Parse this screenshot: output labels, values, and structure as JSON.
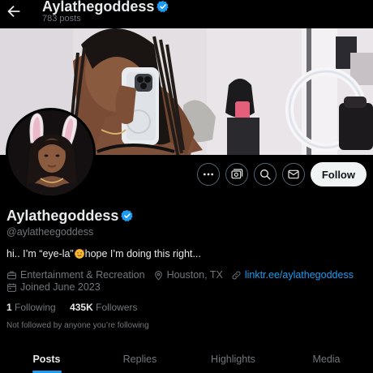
{
  "header": {
    "title": "Aylathegoddess",
    "post_count": "783 posts",
    "back_icon": "arrow-left-icon",
    "verified_icon": "verified-badge-icon"
  },
  "profile": {
    "display_name": "Aylathegoddess",
    "handle": "@aylatheegoddess",
    "bio_before": "hi.. I’m “eye-la”",
    "bio_emoji": "smiling-face-with-hearts-emoji",
    "bio_after": "hope I’m doing this right...",
    "category": "Entertainment & Recreation",
    "location": "Houston, TX",
    "link": "linktr.ee/aylathegoddess",
    "joined": "Joined June 2023",
    "following_count": "1",
    "following_label": "Following",
    "followers_count": "435K",
    "followers_label": "Followers",
    "not_followed_text": "Not followed by anyone you’re following"
  },
  "actions": {
    "more_icon": "more-icon",
    "subscribe_icon": "subscribe-icon",
    "search_icon": "search-icon",
    "message_icon": "message-icon",
    "follow_label": "Follow"
  },
  "tabs": [
    {
      "label": "Posts",
      "active": true
    },
    {
      "label": "Replies",
      "active": false
    },
    {
      "label": "Highlights",
      "active": false
    },
    {
      "label": "Media",
      "active": false
    }
  ],
  "colors": {
    "background": "#000000",
    "accent": "#1d9bf0",
    "muted": "#71767b",
    "text": "#e7e9ea"
  }
}
